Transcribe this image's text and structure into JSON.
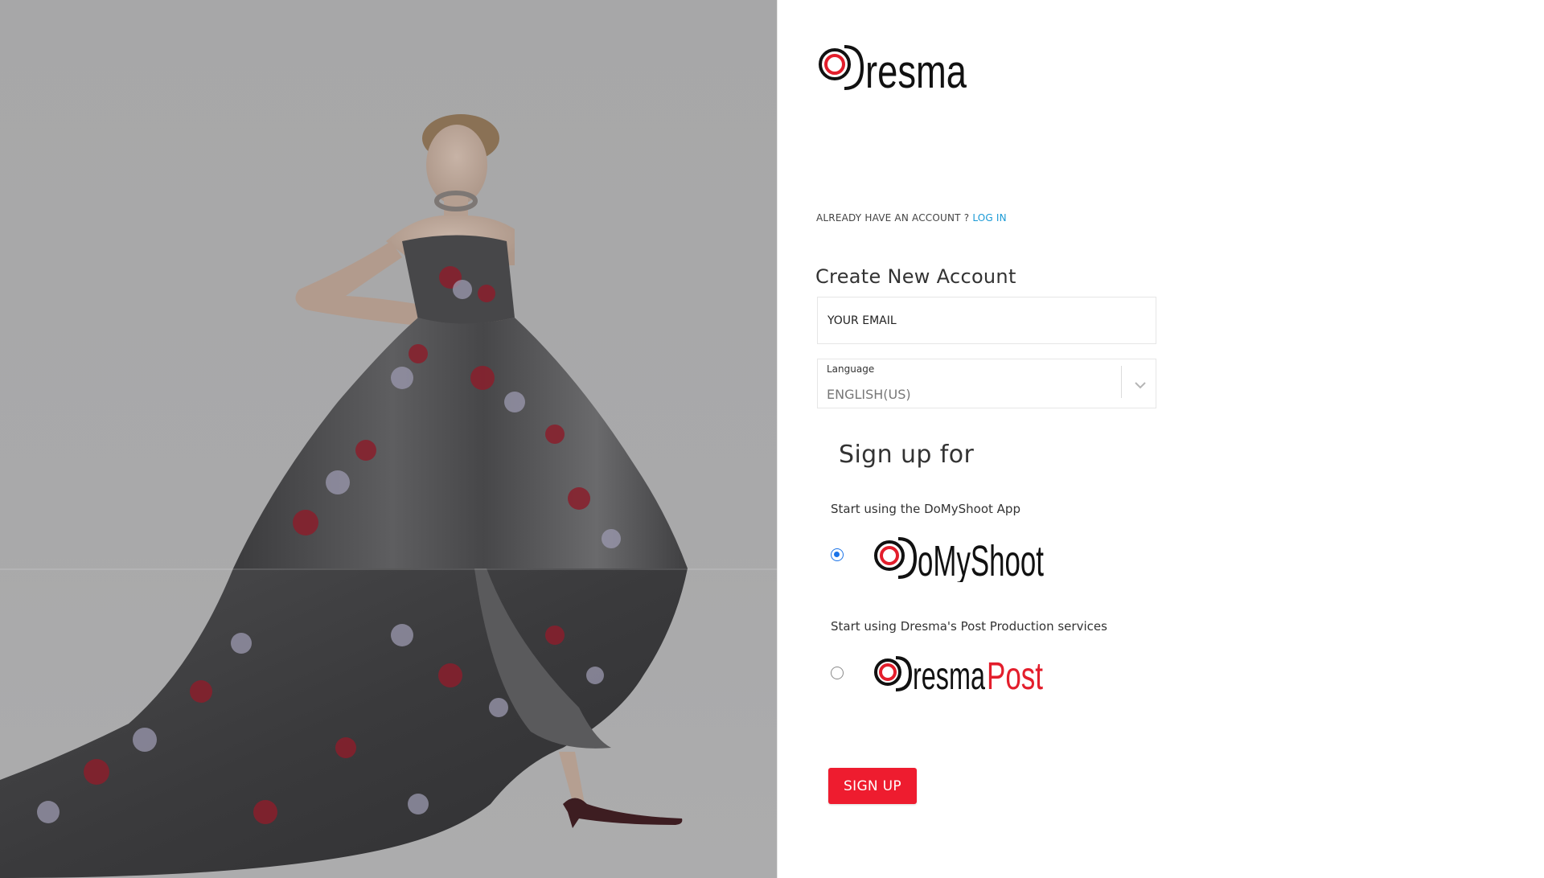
{
  "brand": {
    "name": "Dresma",
    "logo_text": "resma",
    "accent": "#e31e2c"
  },
  "auth": {
    "prompt": "ALREADY HAVE AN ACCOUNT ?",
    "login_link": "LOG IN"
  },
  "form": {
    "title": "Create New Account",
    "email": {
      "placeholder": "YOUR EMAIL",
      "value": ""
    },
    "language": {
      "label": "Language",
      "selected": "ENGLISH(US)"
    }
  },
  "signup_for": {
    "title": "Sign up for",
    "options": [
      {
        "description": "Start using the DoMyShoot App",
        "logo_text": "oMyShoot",
        "selected": true
      },
      {
        "description": "Start using Dresma's Post Production services",
        "logo_text_dark": "resma",
        "logo_text_accent": "Post",
        "selected": false
      }
    ]
  },
  "actions": {
    "signup_label": "SIGN UP",
    "signup_color": "#ee1c2f"
  },
  "colors": {
    "link": "#1a9ad6",
    "radio_selected": "#1a73e8"
  }
}
